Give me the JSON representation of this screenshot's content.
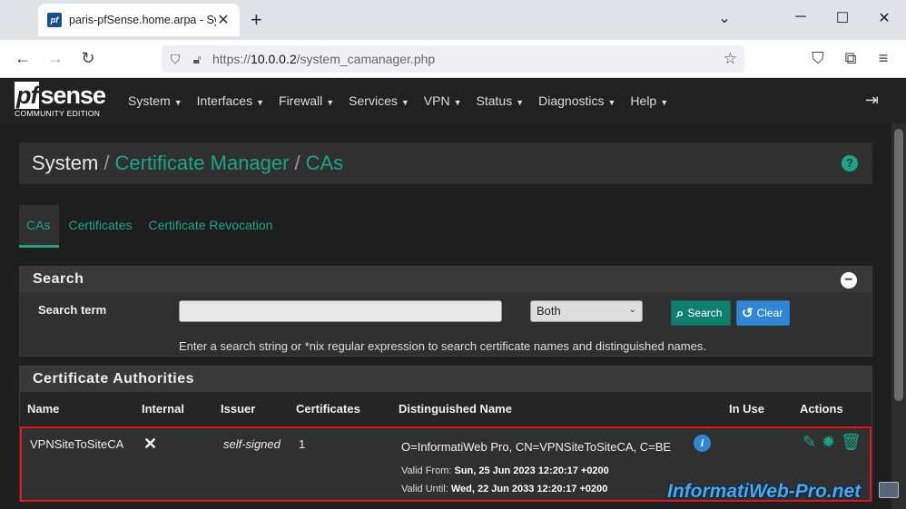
{
  "browser": {
    "tab_title": "paris-pfSense.home.arpa - Syst",
    "favicon_text": "pf",
    "url_proto": "https://",
    "url_host": "10.0.0.2",
    "url_path": "/system_camanager.php"
  },
  "navbar": {
    "logo_main": "sense",
    "logo_pf": "pf",
    "logo_sub": "COMMUNITY EDITION",
    "menu": [
      "System",
      "Interfaces",
      "Firewall",
      "Services",
      "VPN",
      "Status",
      "Diagnostics",
      "Help"
    ]
  },
  "breadcrumb": {
    "system": "System",
    "sep": "/",
    "cert_manager": "Certificate Manager",
    "cas": "CAs"
  },
  "tabs": [
    "CAs",
    "Certificates",
    "Certificate Revocation"
  ],
  "search": {
    "heading": "Search",
    "term_label": "Search term",
    "term_value": "",
    "scope_selected": "Both",
    "search_btn": "Search",
    "clear_btn": "Clear",
    "help_text": "Enter a search string or *nix regular expression to search certificate names and distinguished names."
  },
  "ca_table": {
    "heading": "Certificate Authorities",
    "columns": [
      "Name",
      "Internal",
      "Issuer",
      "Certificates",
      "Distinguished Name",
      "In Use",
      "Actions"
    ],
    "rows": [
      {
        "name": "VPNSiteToSiteCA",
        "issuer": "self-signed",
        "certificates": "1",
        "dn": "O=InformatiWeb Pro, CN=VPNSiteToSiteCA, C=BE",
        "valid_from_label": "Valid From:",
        "valid_from": "Sun, 25 Jun 2023 12:20:17 +0200",
        "valid_until_label": "Valid Until:",
        "valid_until": "Wed, 22 Jun 2033 12:20:17 +0200"
      }
    ]
  },
  "watermark": "InformatiWeb-Pro.net",
  "colors": {
    "accent": "#1aa58a",
    "highlight": "#e0151b",
    "info": "#2e86d4"
  }
}
